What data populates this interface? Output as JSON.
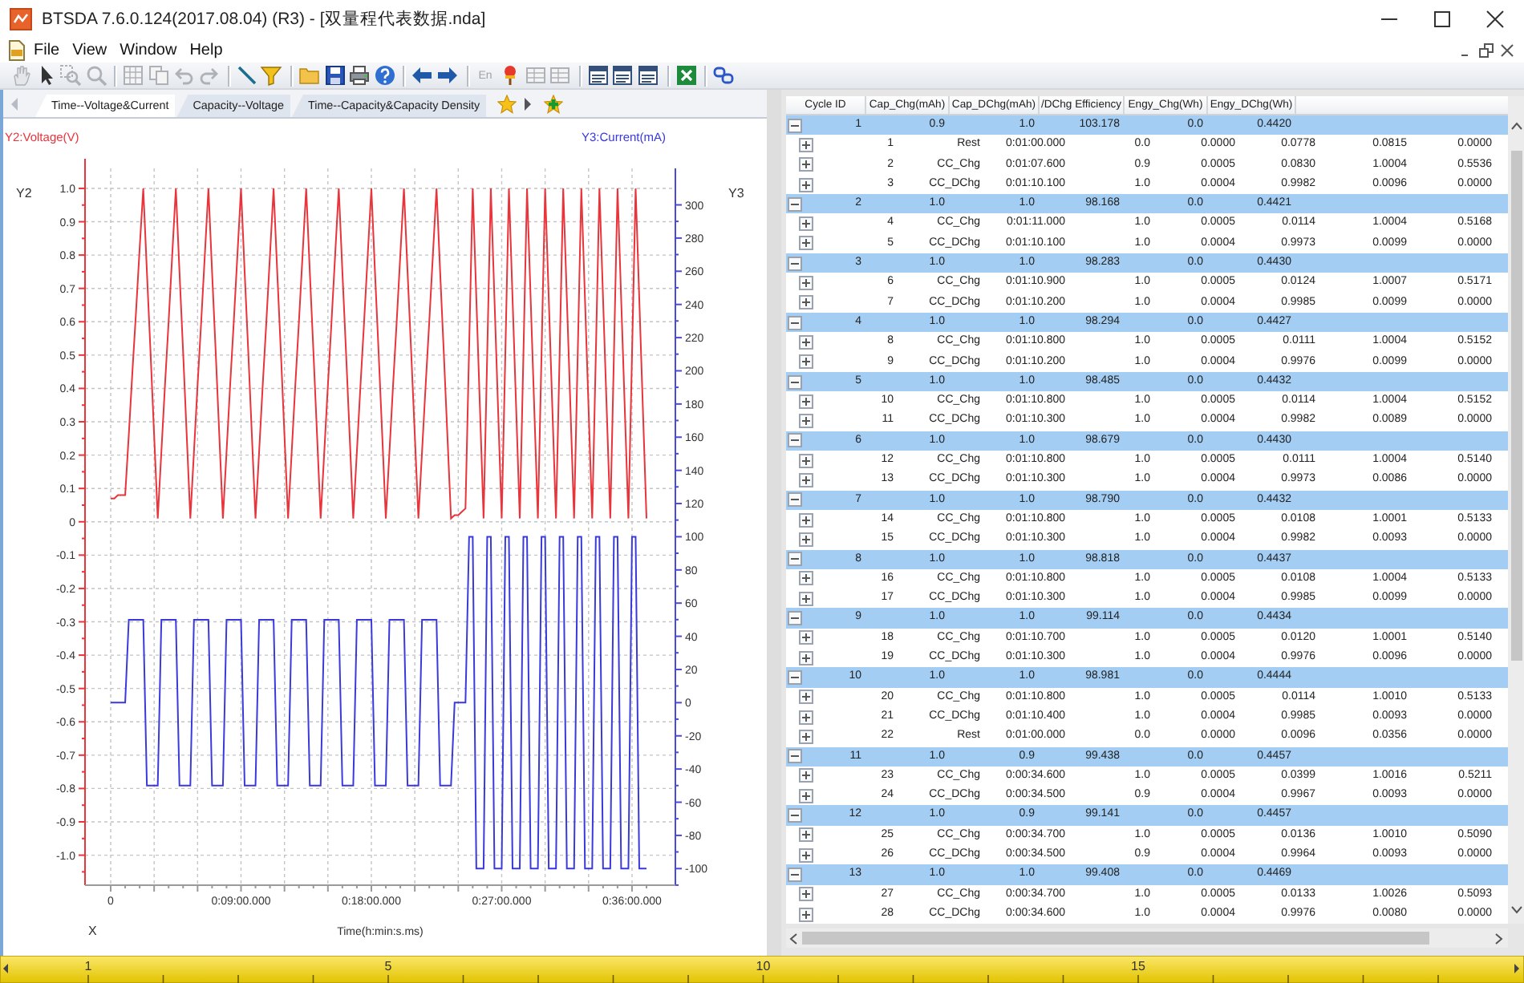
{
  "window": {
    "title": "BTSDA 7.6.0.124(2017.08.04) (R3) - [双量程代表数据.nda]"
  },
  "menu": [
    "File",
    "View",
    "Window",
    "Help"
  ],
  "toolbar": {
    "items": [
      {
        "kind": "hand",
        "disabled": true
      },
      {
        "kind": "pointer",
        "disabled": false
      },
      {
        "kind": "zoomarea",
        "disabled": true
      },
      {
        "kind": "zoom",
        "disabled": true
      },
      {
        "kind": "separator"
      },
      {
        "kind": "grid",
        "disabled": true
      },
      {
        "kind": "copy",
        "disabled": true
      },
      {
        "kind": "undo",
        "disabled": true
      },
      {
        "kind": "redo",
        "disabled": true
      },
      {
        "kind": "separator"
      },
      {
        "kind": "line",
        "disabled": false
      },
      {
        "kind": "filter",
        "disabled": false
      },
      {
        "kind": "separator"
      },
      {
        "kind": "folder",
        "disabled": false
      },
      {
        "kind": "save",
        "disabled": false
      },
      {
        "kind": "print",
        "disabled": false
      },
      {
        "kind": "help",
        "disabled": false
      },
      {
        "kind": "separator"
      },
      {
        "kind": "back",
        "disabled": false
      },
      {
        "kind": "forward",
        "disabled": false
      },
      {
        "kind": "separator"
      },
      {
        "kind": "text",
        "label": "En",
        "disabled": true
      },
      {
        "kind": "pin",
        "disabled": false
      },
      {
        "kind": "table",
        "disabled": true
      },
      {
        "kind": "table",
        "disabled": true
      },
      {
        "kind": "separator"
      },
      {
        "kind": "list",
        "disabled": false
      },
      {
        "kind": "list",
        "disabled": false
      },
      {
        "kind": "list",
        "disabled": false
      },
      {
        "kind": "separator"
      },
      {
        "kind": "excel",
        "disabled": false
      },
      {
        "kind": "separator"
      },
      {
        "kind": "link",
        "disabled": false
      }
    ]
  },
  "tabs": [
    {
      "label": "Time--Voltage&Current",
      "selected": true
    },
    {
      "label": "Capacity--Voltage",
      "selected": false
    },
    {
      "label": "Time--Capacity&Capacity Density",
      "selected": false
    }
  ],
  "chart": {
    "x_axis_name": "X",
    "y_axis_name": "Y2",
    "y2_axis_name": "Y3",
    "chart_data": {
      "type": "line",
      "grid": true,
      "xlabel": "Time(h:min:s.ms)",
      "ylabel": "Y2:Voltage(V)",
      "y2label": "Y3:Current(mA)",
      "categories": [
        "0",
        null,
        null,
        null,
        null,
        null,
        null,
        null,
        null,
        null,
        null,
        null,
        null,
        null,
        null,
        null,
        null,
        null,
        null,
        null,
        null,
        null,
        null,
        null,
        null,
        null,
        null,
        null,
        null,
        null,
        null,
        null,
        null,
        null,
        null,
        null,
        "0:09:00.000",
        null,
        null,
        null,
        null,
        null,
        null,
        null,
        null,
        null,
        null,
        null,
        null,
        null,
        null,
        null,
        null,
        null,
        null,
        null,
        null,
        null,
        null,
        null,
        null,
        null,
        null,
        null,
        null,
        null,
        null,
        null,
        null,
        null,
        null,
        null,
        "0:18:00.000",
        null,
        null,
        null,
        null,
        null,
        null,
        null,
        null,
        null,
        null,
        null,
        null,
        null,
        null,
        null,
        null,
        null,
        null,
        null,
        null,
        null,
        null,
        null,
        null,
        null,
        null,
        null,
        null,
        null,
        null,
        null,
        null,
        null,
        null,
        null,
        "0:27:00.000",
        null,
        null,
        null,
        null,
        null,
        null,
        null,
        null,
        null,
        null,
        null,
        null,
        null,
        null,
        null,
        null,
        null,
        null,
        null,
        null,
        null,
        null,
        null,
        null,
        null,
        null,
        null,
        null,
        null,
        null,
        null,
        null,
        null,
        null,
        null,
        "0:36:00.000",
        null,
        null,
        null,
        null
      ],
      "series": [
        {
          "color": "#e8343a",
          "axis": "y",
          "values": [
            0.07,
            0.07,
            0.08,
            0.08,
            0.08,
            0.26,
            0.45,
            0.63,
            0.82,
            1,
            0.75,
            0.51,
            0.26,
            0.01,
            0.21,
            0.41,
            0.6,
            0.8,
            1,
            0.75,
            0.51,
            0.26,
            0.01,
            0.21,
            0.41,
            0.6,
            0.8,
            1,
            0.75,
            0.51,
            0.26,
            0.01,
            0.21,
            0.41,
            0.6,
            0.8,
            1,
            0.75,
            0.51,
            0.26,
            0.01,
            0.21,
            0.41,
            0.6,
            0.8,
            1,
            0.75,
            0.51,
            0.26,
            0.01,
            0.21,
            0.41,
            0.6,
            0.8,
            1,
            0.75,
            0.51,
            0.26,
            0.01,
            0.21,
            0.41,
            0.6,
            0.8,
            1,
            0.75,
            0.51,
            0.26,
            0.01,
            0.21,
            0.41,
            0.6,
            0.8,
            1,
            0.75,
            0.51,
            0.26,
            0.01,
            0.21,
            0.41,
            0.6,
            0.8,
            1,
            0.75,
            0.51,
            0.26,
            0.01,
            0.21,
            0.41,
            0.6,
            0.8,
            1,
            0.75,
            0.51,
            0.26,
            0.01,
            0.02,
            0.02,
            0.03,
            0.04,
            0.52,
            1,
            0.67,
            0.34,
            0.01,
            0.5,
            1,
            0.67,
            0.34,
            0.01,
            0.5,
            1,
            0.67,
            0.34,
            0.01,
            0.5,
            1,
            0.67,
            0.34,
            0.01,
            0.5,
            1,
            0.67,
            0.34,
            0.01,
            0.5,
            1,
            0.67,
            0.34,
            0.01,
            0.5,
            1,
            0.67,
            0.34,
            0.01,
            0.5,
            1,
            0.67,
            0.34,
            0.01,
            0.5,
            1,
            0.67,
            0.34,
            0.01,
            0.5,
            1,
            0.67,
            0.34,
            0.01
          ]
        },
        {
          "color": "#3a3adc",
          "axis": "y2",
          "values": [
            0,
            0,
            0,
            0,
            0,
            50,
            50,
            50,
            50,
            50,
            -50,
            -50,
            -50,
            -50,
            50,
            50,
            50,
            50,
            50,
            -50,
            -50,
            -50,
            -50,
            50,
            50,
            50,
            50,
            50,
            -50,
            -50,
            -50,
            -50,
            50,
            50,
            50,
            50,
            50,
            -50,
            -50,
            -50,
            -50,
            50,
            50,
            50,
            50,
            50,
            -50,
            -50,
            -50,
            -50,
            50,
            50,
            50,
            50,
            50,
            -50,
            -50,
            -50,
            -50,
            50,
            50,
            50,
            50,
            50,
            -50,
            -50,
            -50,
            -50,
            50,
            50,
            50,
            50,
            50,
            -50,
            -50,
            -50,
            -50,
            50,
            50,
            50,
            50,
            50,
            -50,
            -50,
            -50,
            -50,
            50,
            50,
            50,
            50,
            50,
            -50,
            -50,
            -50,
            -50,
            0,
            0,
            0,
            0,
            100,
            100,
            -100,
            -100,
            -100,
            100,
            100,
            -100,
            -100,
            -100,
            100,
            100,
            -100,
            -100,
            -100,
            100,
            100,
            -100,
            -100,
            -100,
            100,
            100,
            -100,
            -100,
            -100,
            100,
            100,
            -100,
            -100,
            -100,
            100,
            100,
            -100,
            -100,
            -100,
            100,
            100,
            -100,
            -100,
            -100,
            100,
            100,
            -100,
            -100,
            -100,
            100,
            100,
            -100,
            -100,
            -100
          ]
        }
      ],
      "ylim": [
        -1.09,
        1.06
      ],
      "y2lim": [
        -110,
        322
      ],
      "yticks": [
        {
          "value": 1,
          "label": "1.0"
        },
        0.9,
        0.8,
        0.7,
        0.6,
        0.5,
        0.4,
        0.3,
        0.2,
        0.1,
        0,
        -0.1,
        -0.2,
        -0.3,
        -0.4,
        -0.5,
        -0.6,
        -0.7,
        -0.8,
        -0.9,
        {
          "value": -1,
          "label": "-1.0"
        }
      ],
      "y2ticks": [
        300,
        280,
        260,
        240,
        220,
        200,
        180,
        160,
        140,
        120,
        100,
        80,
        60,
        40,
        20,
        0,
        -20,
        -40,
        -60,
        -80,
        -100
      ]
    }
  },
  "table": {
    "columns": [
      "Cycle ID",
      "Cap_Chg(mAh)",
      "Cap_DChg(mAh)",
      "/DChg Efficiency",
      "Engy_Chg(Wh)",
      "Engy_DChg(Wh)"
    ],
    "rows": [
      {
        "cells": [
          "1",
          "0.9",
          "1.0",
          "103.178",
          "0.0",
          "0.4420"
        ],
        "expanded": true,
        "children": [
          {
            "cells": [
              "1",
              "Rest",
              "0:01:00.000",
              "0.0",
              "0.0000",
              "0.0778",
              "0.0815",
              "0.0000"
            ],
            "expanded": false
          },
          {
            "cells": [
              "2",
              "CC_Chg",
              "0:01:07.600",
              "0.9",
              "0.0005",
              "0.0830",
              "1.0004",
              "0.5536"
            ],
            "expanded": false
          },
          {
            "cells": [
              "3",
              "CC_DChg",
              "0:01:10.100",
              "1.0",
              "0.0004",
              "0.9982",
              "0.0096",
              "0.0000"
            ],
            "expanded": false
          }
        ]
      },
      {
        "cells": [
          "2",
          "1.0",
          "1.0",
          "98.168",
          "0.0",
          "0.4421"
        ],
        "expanded": true,
        "children": [
          {
            "cells": [
              "4",
              "CC_Chg",
              "0:01:11.000",
              "1.0",
              "0.0005",
              "0.0114",
              "1.0004",
              "0.5168"
            ],
            "expanded": false
          },
          {
            "cells": [
              "5",
              "CC_DChg",
              "0:01:10.100",
              "1.0",
              "0.0004",
              "0.9973",
              "0.0099",
              "0.0000"
            ],
            "expanded": false
          }
        ]
      },
      {
        "cells": [
          "3",
          "1.0",
          "1.0",
          "98.283",
          "0.0",
          "0.4430"
        ],
        "expanded": true,
        "children": [
          {
            "cells": [
              "6",
              "CC_Chg",
              "0:01:10.900",
              "1.0",
              "0.0005",
              "0.0124",
              "1.0007",
              "0.5171"
            ],
            "expanded": false
          },
          {
            "cells": [
              "7",
              "CC_DChg",
              "0:01:10.200",
              "1.0",
              "0.0004",
              "0.9985",
              "0.0099",
              "0.0000"
            ],
            "expanded": false
          }
        ]
      },
      {
        "cells": [
          "4",
          "1.0",
          "1.0",
          "98.294",
          "0.0",
          "0.4427"
        ],
        "expanded": true,
        "children": [
          {
            "cells": [
              "8",
              "CC_Chg",
              "0:01:10.800",
              "1.0",
              "0.0005",
              "0.0111",
              "1.0004",
              "0.5152"
            ],
            "expanded": false
          },
          {
            "cells": [
              "9",
              "CC_DChg",
              "0:01:10.200",
              "1.0",
              "0.0004",
              "0.9976",
              "0.0099",
              "0.0000"
            ],
            "expanded": false
          }
        ]
      },
      {
        "cells": [
          "5",
          "1.0",
          "1.0",
          "98.485",
          "0.0",
          "0.4432"
        ],
        "expanded": true,
        "children": [
          {
            "cells": [
              "10",
              "CC_Chg",
              "0:01:10.800",
              "1.0",
              "0.0005",
              "0.0114",
              "1.0004",
              "0.5152"
            ],
            "expanded": false
          },
          {
            "cells": [
              "11",
              "CC_DChg",
              "0:01:10.300",
              "1.0",
              "0.0004",
              "0.9982",
              "0.0089",
              "0.0000"
            ],
            "expanded": false
          }
        ]
      },
      {
        "cells": [
          "6",
          "1.0",
          "1.0",
          "98.679",
          "0.0",
          "0.4430"
        ],
        "expanded": true,
        "children": [
          {
            "cells": [
              "12",
              "CC_Chg",
              "0:01:10.800",
              "1.0",
              "0.0005",
              "0.0111",
              "1.0004",
              "0.5140"
            ],
            "expanded": false
          },
          {
            "cells": [
              "13",
              "CC_DChg",
              "0:01:10.300",
              "1.0",
              "0.0004",
              "0.9973",
              "0.0086",
              "0.0000"
            ],
            "expanded": false
          }
        ]
      },
      {
        "cells": [
          "7",
          "1.0",
          "1.0",
          "98.790",
          "0.0",
          "0.4432"
        ],
        "expanded": true,
        "children": [
          {
            "cells": [
              "14",
              "CC_Chg",
              "0:01:10.800",
              "1.0",
              "0.0005",
              "0.0108",
              "1.0001",
              "0.5133"
            ],
            "expanded": false
          },
          {
            "cells": [
              "15",
              "CC_DChg",
              "0:01:10.300",
              "1.0",
              "0.0004",
              "0.9982",
              "0.0093",
              "0.0000"
            ],
            "expanded": false
          }
        ]
      },
      {
        "cells": [
          "8",
          "1.0",
          "1.0",
          "98.818",
          "0.0",
          "0.4437"
        ],
        "expanded": true,
        "children": [
          {
            "cells": [
              "16",
              "CC_Chg",
              "0:01:10.800",
              "1.0",
              "0.0005",
              "0.0108",
              "1.0004",
              "0.5133"
            ],
            "expanded": false
          },
          {
            "cells": [
              "17",
              "CC_DChg",
              "0:01:10.300",
              "1.0",
              "0.0004",
              "0.9985",
              "0.0099",
              "0.0000"
            ],
            "expanded": false
          }
        ]
      },
      {
        "cells": [
          "9",
          "1.0",
          "1.0",
          "99.114",
          "0.0",
          "0.4434"
        ],
        "expanded": true,
        "children": [
          {
            "cells": [
              "18",
              "CC_Chg",
              "0:01:10.700",
              "1.0",
              "0.0005",
              "0.0120",
              "1.0001",
              "0.5140"
            ],
            "expanded": false
          },
          {
            "cells": [
              "19",
              "CC_DChg",
              "0:01:10.300",
              "1.0",
              "0.0004",
              "0.9976",
              "0.0096",
              "0.0000"
            ],
            "expanded": false
          }
        ]
      },
      {
        "cells": [
          "10",
          "1.0",
          "1.0",
          "98.981",
          "0.0",
          "0.4444"
        ],
        "expanded": true,
        "children": [
          {
            "cells": [
              "20",
              "CC_Chg",
              "0:01:10.800",
              "1.0",
              "0.0005",
              "0.0114",
              "1.0010",
              "0.5133"
            ],
            "expanded": false
          },
          {
            "cells": [
              "21",
              "CC_DChg",
              "0:01:10.400",
              "1.0",
              "0.0004",
              "0.9985",
              "0.0093",
              "0.0000"
            ],
            "expanded": false
          },
          {
            "cells": [
              "22",
              "Rest",
              "0:01:00.000",
              "0.0",
              "0.0000",
              "0.0096",
              "0.0356",
              "0.0000"
            ],
            "expanded": false
          }
        ]
      },
      {
        "cells": [
          "11",
          "1.0",
          "0.9",
          "99.438",
          "0.0",
          "0.4457"
        ],
        "expanded": true,
        "children": [
          {
            "cells": [
              "23",
              "CC_Chg",
              "0:00:34.600",
              "1.0",
              "0.0005",
              "0.0399",
              "1.0016",
              "0.5211"
            ],
            "expanded": false
          },
          {
            "cells": [
              "24",
              "CC_DChg",
              "0:00:34.500",
              "0.9",
              "0.0004",
              "0.9967",
              "0.0093",
              "0.0000"
            ],
            "expanded": false
          }
        ]
      },
      {
        "cells": [
          "12",
          "1.0",
          "0.9",
          "99.141",
          "0.0",
          "0.4457"
        ],
        "expanded": true,
        "children": [
          {
            "cells": [
              "25",
              "CC_Chg",
              "0:00:34.700",
              "1.0",
              "0.0005",
              "0.0136",
              "1.0010",
              "0.5090"
            ],
            "expanded": false
          },
          {
            "cells": [
              "26",
              "CC_DChg",
              "0:00:34.500",
              "0.9",
              "0.0004",
              "0.9964",
              "0.0093",
              "0.0000"
            ],
            "expanded": false
          }
        ]
      },
      {
        "cells": [
          "13",
          "1.0",
          "1.0",
          "99.408",
          "0.0",
          "0.4469"
        ],
        "expanded": true,
        "children": [
          {
            "cells": [
              "27",
              "CC_Chg",
              "0:00:34.700",
              "1.0",
              "0.0005",
              "0.0133",
              "1.0026",
              "0.5093"
            ],
            "expanded": false
          },
          {
            "cells": [
              "28",
              "CC_DChg",
              "0:00:34.600",
              "1.0",
              "0.0004",
              "0.9976",
              "0.0080",
              "0.0000"
            ],
            "expanded": false
          }
        ]
      }
    ]
  },
  "ruler": {
    "labels": [
      "1",
      "5",
      "10",
      "15"
    ]
  }
}
